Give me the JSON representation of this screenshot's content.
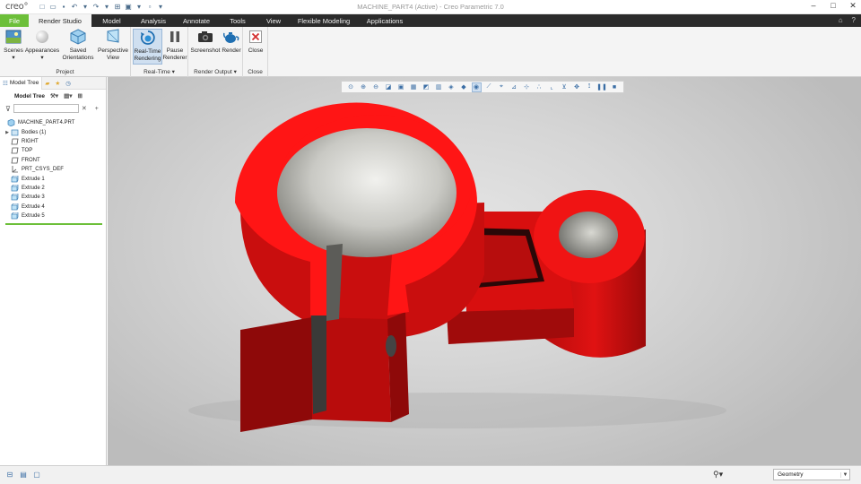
{
  "app": {
    "logo": "creo°",
    "window_title": "MACHINE_PART4 (Active) - Creo Parametric 7.0"
  },
  "menu": {
    "tabs": [
      {
        "label": "File"
      },
      {
        "label": "Render Studio"
      },
      {
        "label": "Model"
      },
      {
        "label": "Analysis"
      },
      {
        "label": "Annotate"
      },
      {
        "label": "Tools"
      },
      {
        "label": "View"
      },
      {
        "label": "Flexible Modeling"
      },
      {
        "label": "Applications"
      }
    ]
  },
  "ribbon": {
    "groups": {
      "project": "Project",
      "realtime": "Real-Time ▾",
      "render_output": "Render Output ▾",
      "close": "Close"
    },
    "buttons": {
      "scenes": "Scenes",
      "appearances": "Appearances",
      "saved_orientations_1": "Saved",
      "saved_orientations_2": "Orientations",
      "perspective_1": "Perspective",
      "perspective_2": "View",
      "realtime_1": "Real-Time",
      "realtime_2": "Rendering",
      "pause_1": "Pause",
      "pause_2": "Renderer",
      "screenshot": "Screenshot",
      "render": "Render",
      "close": "Close"
    }
  },
  "panel": {
    "tab_label": "Model Tree",
    "toolbar_label": "Model Tree",
    "filter_placeholder": "",
    "tree": [
      {
        "label": "MACHINE_PART4.PRT",
        "icon": "part-icon",
        "expander": ""
      },
      {
        "label": "Bodies (1)",
        "icon": "bodies-icon",
        "expander": "▶"
      },
      {
        "label": "RIGHT",
        "icon": "datum-plane-icon",
        "expander": ""
      },
      {
        "label": "TOP",
        "icon": "datum-plane-icon",
        "expander": ""
      },
      {
        "label": "FRONT",
        "icon": "datum-plane-icon",
        "expander": ""
      },
      {
        "label": "PRT_CSYS_DEF",
        "icon": "csys-icon",
        "expander": ""
      },
      {
        "label": "Extrude 1",
        "icon": "extrude-icon",
        "expander": ""
      },
      {
        "label": "Extrude 2",
        "icon": "extrude-icon",
        "expander": ""
      },
      {
        "label": "Extrude 3",
        "icon": "extrude-icon",
        "expander": ""
      },
      {
        "label": "Extrude 4",
        "icon": "extrude-icon",
        "expander": ""
      },
      {
        "label": "Extrude 5",
        "icon": "extrude-icon",
        "expander": ""
      }
    ]
  },
  "status": {
    "filter_value": "Geometry"
  },
  "colors": {
    "file_tab": "#6cbf39",
    "menu_bar": "#2b2b2b",
    "model_red": "#e8100e",
    "accent": "#3b6ea5"
  }
}
